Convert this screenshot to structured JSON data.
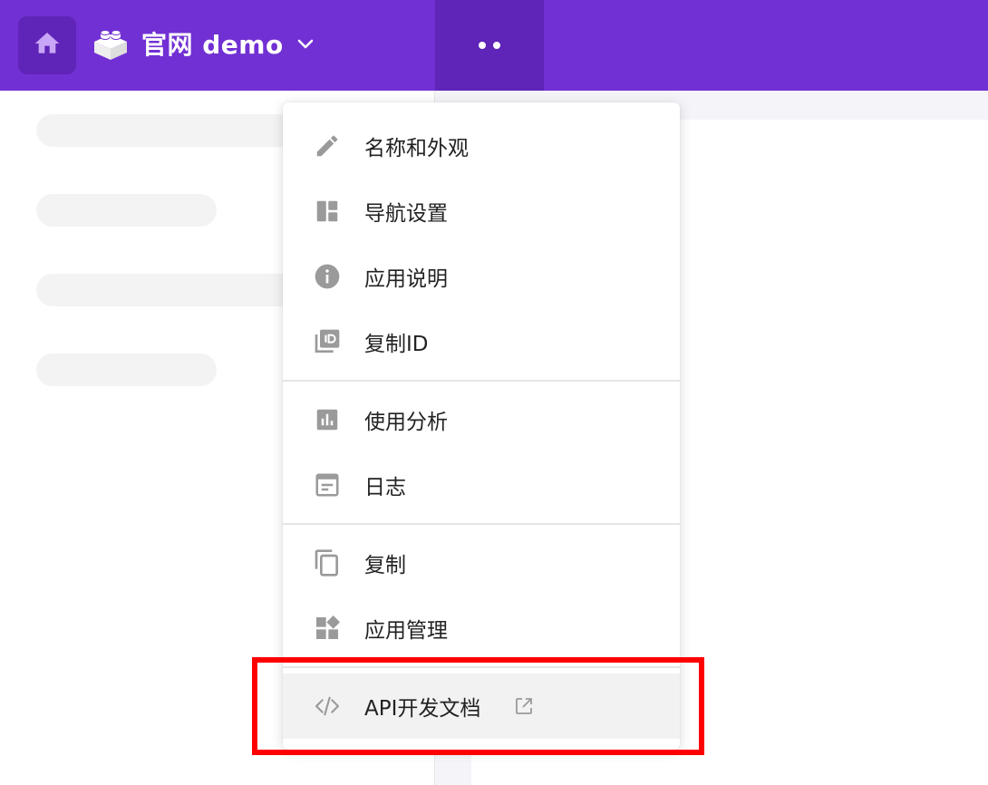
{
  "colors": {
    "brand": "#7130d3",
    "brand_dark": "#5f24b8",
    "highlight": "#ff0000",
    "icon": "#9a9a9a"
  },
  "header": {
    "app_title": "官网 demo"
  },
  "menu": {
    "items": [
      {
        "label": "名称和外观",
        "icon": "pencil-icon"
      },
      {
        "label": "导航设置",
        "icon": "layout-icon"
      },
      {
        "label": "应用说明",
        "icon": "info-icon"
      },
      {
        "label": "复制ID",
        "icon": "id-card-icon"
      },
      {
        "label": "使用分析",
        "icon": "bar-chart-icon"
      },
      {
        "label": "日志",
        "icon": "log-icon"
      },
      {
        "label": "复制",
        "icon": "copy-icon"
      },
      {
        "label": "应用管理",
        "icon": "apps-icon"
      },
      {
        "label": "API开发文档",
        "icon": "code-icon",
        "trailing_icon": "external-link-icon"
      }
    ]
  }
}
